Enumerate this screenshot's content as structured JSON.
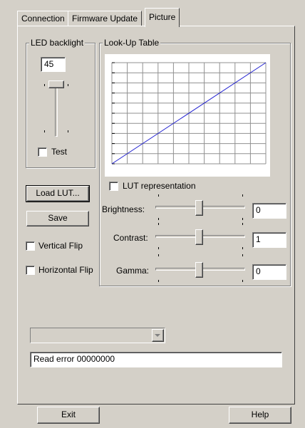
{
  "tabs": [
    {
      "label": "Connection"
    },
    {
      "label": "Firmware Update"
    },
    {
      "label": "Picture"
    }
  ],
  "led": {
    "group_label": "LED backlight",
    "value": "45",
    "test_label": "Test",
    "test_checked": false
  },
  "lut": {
    "group_label": "Look-Up Table",
    "representation_label": "LUT representation",
    "representation_checked": false
  },
  "buttons": {
    "load_lut": "Load LUT...",
    "save": "Save",
    "exit": "Exit",
    "help": "Help"
  },
  "flip": {
    "vertical_label": "Vertical Flip",
    "vertical_checked": false,
    "horizontal_label": "Horizontal Flip",
    "horizontal_checked": false
  },
  "sliders": {
    "brightness": {
      "label": "Brightness:",
      "value": "0"
    },
    "contrast": {
      "label": "Contrast:",
      "value": "1"
    },
    "gamma": {
      "label": "Gamma:",
      "value": "0"
    }
  },
  "status": {
    "dropdown_value": "",
    "message": "Read error 00000000"
  },
  "colors": {
    "curve": "#2020d0",
    "grid": "#909090",
    "background": "#d4d0c8"
  },
  "chart_data": {
    "type": "line",
    "x": [
      0,
      1
    ],
    "y": [
      0,
      1
    ],
    "grid": true
  }
}
